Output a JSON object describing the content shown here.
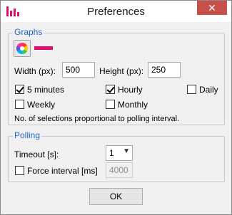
{
  "window": {
    "title": "Preferences",
    "close_label": "✕"
  },
  "graphs": {
    "group_label": "Graphs",
    "color": "#e0106a",
    "width_label": "Width (px):",
    "width_value": "500",
    "height_label": "Height (px):",
    "height_value": "250",
    "options": [
      {
        "label": "5 minutes",
        "checked": true
      },
      {
        "label": "Hourly",
        "checked": true
      },
      {
        "label": "Daily",
        "checked": false
      },
      {
        "label": "Weekly",
        "checked": false
      },
      {
        "label": "Monthly",
        "checked": false
      }
    ],
    "note": "No. of selections proportional to polling interval."
  },
  "polling": {
    "group_label": "Polling",
    "timeout_label": "Timeout [s]:",
    "timeout_value": "1",
    "force_label": "Force interval [ms]",
    "force_checked": false,
    "force_value": "4000"
  },
  "footer": {
    "ok_label": "OK"
  }
}
